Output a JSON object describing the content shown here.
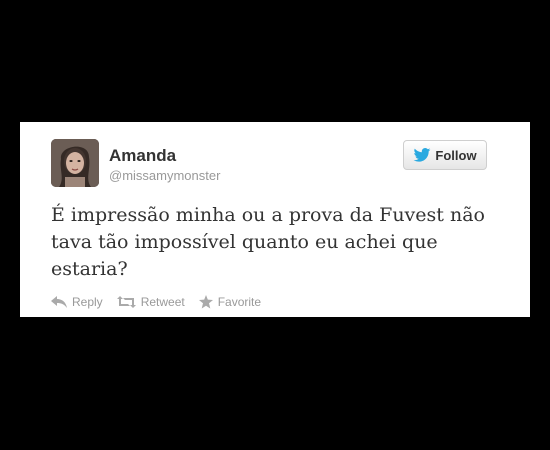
{
  "tweet": {
    "author_name": "Amanda",
    "author_handle": "@missamymonster",
    "text": "É impressão minha ou a prova da Fuvest não tava tão impossível quanto eu achei que estaria?",
    "follow_label": "Follow",
    "follow_icon": "twitter-bird-icon",
    "actions": {
      "reply": {
        "label": "Reply",
        "icon": "reply-arrow-icon"
      },
      "retweet": {
        "label": "Retweet",
        "icon": "retweet-icon"
      },
      "favorite": {
        "label": "Favorite",
        "icon": "star-icon"
      }
    }
  },
  "colors": {
    "background": "#000000",
    "card": "#ffffff",
    "text": "#333333",
    "muted": "#999999",
    "twitter_blue": "#2aa9e0"
  }
}
